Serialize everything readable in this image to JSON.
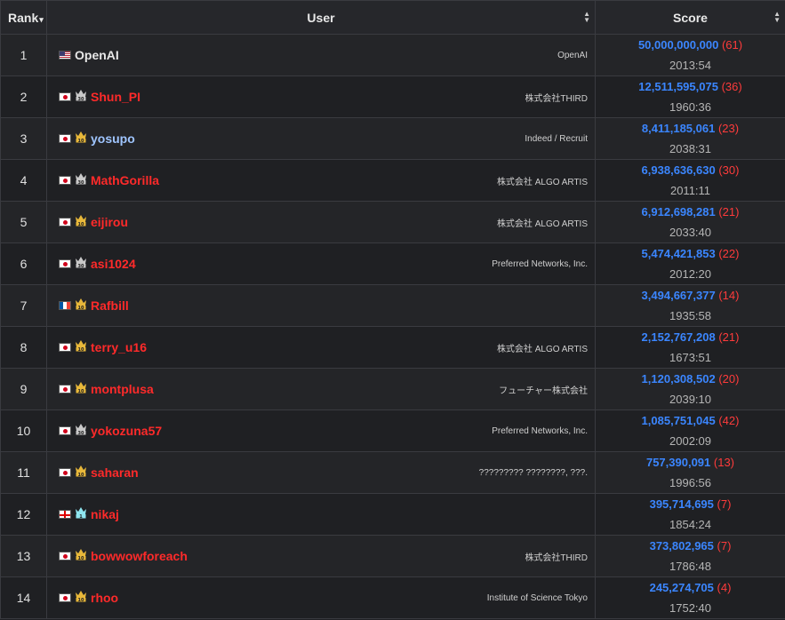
{
  "header": {
    "rank": "Rank",
    "user": "User",
    "score": "Score",
    "sort_up": "▲",
    "sort_down": "▼",
    "rank_caret": "▾"
  },
  "rows": [
    {
      "rank": "1",
      "flag": "us",
      "crown": "",
      "name": "OpenAI",
      "name_color": "white",
      "affiliation": "OpenAI",
      "score": "50,000,000,000",
      "penalty": "(61)",
      "time": "2013:54"
    },
    {
      "rank": "2",
      "flag": "jp",
      "crown": "30",
      "name": "Shun_PI",
      "name_color": "red",
      "affiliation": "株式会社THIRD",
      "score": "12,511,595,075",
      "penalty": "(36)",
      "time": "1960:36"
    },
    {
      "rank": "3",
      "flag": "jp",
      "crown": "10",
      "name": "yosupo",
      "name_color": "blue",
      "affiliation": "Indeed / Recruit",
      "score": "8,411,185,061",
      "penalty": "(23)",
      "time": "2038:31"
    },
    {
      "rank": "4",
      "flag": "jp",
      "crown": "30",
      "name": "MathGorilla",
      "name_color": "red",
      "affiliation": "株式会社 ALGO ARTIS",
      "score": "6,938,636,630",
      "penalty": "(30)",
      "time": "2011:11"
    },
    {
      "rank": "5",
      "flag": "jp",
      "crown": "10",
      "name": "eijirou",
      "name_color": "red",
      "affiliation": "株式会社 ALGO ARTIS",
      "score": "6,912,698,281",
      "penalty": "(21)",
      "time": "2033:40"
    },
    {
      "rank": "6",
      "flag": "jp",
      "crown": "30",
      "name": "asi1024",
      "name_color": "red",
      "affiliation": "Preferred Networks, Inc.",
      "score": "5,474,421,853",
      "penalty": "(22)",
      "time": "2012:20"
    },
    {
      "rank": "7",
      "flag": "fr",
      "crown": "10",
      "name": "Rafbill",
      "name_color": "red",
      "affiliation": "",
      "score": "3,494,667,377",
      "penalty": "(14)",
      "time": "1935:58"
    },
    {
      "rank": "8",
      "flag": "jp",
      "crown": "10",
      "name": "terry_u16",
      "name_color": "red",
      "affiliation": "株式会社 ALGO ARTIS",
      "score": "2,152,767,208",
      "penalty": "(21)",
      "time": "1673:51"
    },
    {
      "rank": "9",
      "flag": "jp",
      "crown": "10",
      "name": "montplusa",
      "name_color": "red",
      "affiliation": "フューチャー株式会社",
      "score": "1,120,308,502",
      "penalty": "(20)",
      "time": "2039:10"
    },
    {
      "rank": "10",
      "flag": "jp",
      "crown": "30",
      "name": "yokozuna57",
      "name_color": "red",
      "affiliation": "Preferred Networks, Inc.",
      "score": "1,085,751,045",
      "penalty": "(42)",
      "time": "2002:09"
    },
    {
      "rank": "11",
      "flag": "jp",
      "crown": "10",
      "name": "saharan",
      "name_color": "red",
      "affiliation": "????????? ????????, ???.",
      "score": "757,390,091",
      "penalty": "(13)",
      "time": "1996:56"
    },
    {
      "rank": "12",
      "flag": "ge",
      "crown": "1",
      "name": "nikaj",
      "name_color": "red",
      "affiliation": "",
      "score": "395,714,695",
      "penalty": "(7)",
      "time": "1854:24"
    },
    {
      "rank": "13",
      "flag": "jp",
      "crown": "10",
      "name": "bowwowforeach",
      "name_color": "red",
      "affiliation": "株式会社THIRD",
      "score": "373,802,965",
      "penalty": "(7)",
      "time": "1786:48"
    },
    {
      "rank": "14",
      "flag": "jp",
      "crown": "10",
      "name": "rhoo",
      "name_color": "red",
      "affiliation": "Institute of Science Tokyo",
      "score": "245,274,705",
      "penalty": "(4)",
      "time": "1752:40"
    }
  ],
  "colors": {
    "gold_crown": "#e8b83a",
    "silver_crown": "#c9c9c9",
    "cyan_crown": "#8fe6f0",
    "score_blue": "#3b86ff",
    "penalty_red": "#ff3b3b",
    "name_red": "#ff2a2a"
  }
}
